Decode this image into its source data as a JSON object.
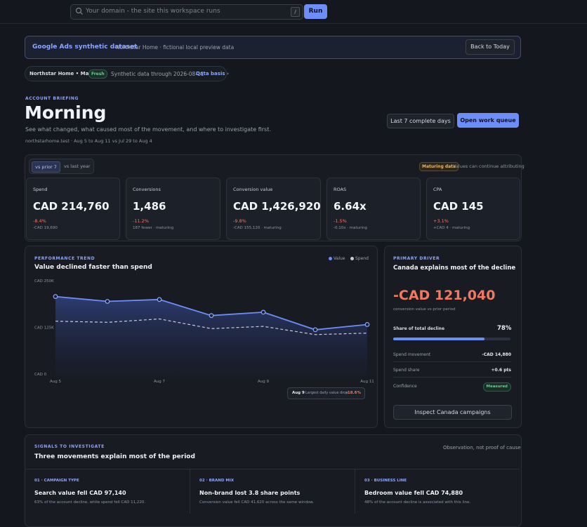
{
  "search": {
    "placeholder": "Your domain - the site this workspace runs",
    "shortcut": "/",
    "run_label": "Run"
  },
  "banner": {
    "title": "Google Ads synthetic dataset",
    "subtitle": "Northstar Home · fictional local preview data",
    "back_label": "Back to Today"
  },
  "status_pill": {
    "account": "Northstar Home • Main",
    "badge": "Fresh",
    "note": "Synthetic data through 2026-08-11",
    "link": "Data basis ›"
  },
  "briefing": {
    "eyebrow": "ACCOUNT BRIEFING",
    "title": "Morning",
    "subtitle": "See what changed, what caused most of the movement, and where to investigate first.",
    "meta": "northstarhome.test · Aug 5 to Aug 11 vs Jul 29 to Aug 4",
    "range_label": "Last 7 complete days",
    "queue_label": "Open work queue"
  },
  "comparison": {
    "prior": "vs prior 7",
    "last_year": "vs last year",
    "maturing_badge": "Maturing data",
    "maturing_note": "Values can continue attributing"
  },
  "kpis": [
    {
      "label": "Spend",
      "value": "CAD 214,760",
      "change": "-8.4%",
      "detail": "-CAD 19,690",
      "change_color": "#f0795f"
    },
    {
      "label": "Conversions",
      "value": "1,486",
      "change": "-11.2%",
      "detail": "187 fewer · maturing",
      "change_color": "#f0795f"
    },
    {
      "label": "Conversion value",
      "value": "CAD 1,426,920",
      "change": "-9.8%",
      "detail": "-CAD 155,120 · maturing",
      "change_color": "#f0795f"
    },
    {
      "label": "ROAS",
      "value": "6.64x",
      "change": "-1.5%",
      "detail": "-0.10x · maturing",
      "change_color": "#f0795f"
    },
    {
      "label": "CPA",
      "value": "CAD 145",
      "change": "+3.1%",
      "detail": "+CAD 4 · maturing",
      "change_color": "#f0795f"
    }
  ],
  "trend": {
    "eyebrow": "PERFORMANCE TREND",
    "title": "Value declined faster than spend",
    "legend_value": "Value",
    "legend_spend": "Spend",
    "callout_day": "Aug 9",
    "callout_text": "Largest daily value drop",
    "callout_change": "-18.6%"
  },
  "chart_data": {
    "type": "line",
    "x": [
      "Aug 5",
      "Aug 6",
      "Aug 7",
      "Aug 8",
      "Aug 9",
      "Aug 10",
      "Aug 11"
    ],
    "x_tick_labels": [
      "Aug 5",
      "Aug 7",
      "Aug 9",
      "Aug 11"
    ],
    "y_tick_labels": [
      "CAD 250K",
      "CAD 125K",
      "CAD 0"
    ],
    "ylim": [
      0,
      250000
    ],
    "series": [
      {
        "name": "Value",
        "values": [
          217000,
          204000,
          209000,
          166000,
          175000,
          128000,
          142000
        ],
        "color": "#6e8ef7",
        "markers": true,
        "area": true
      },
      {
        "name": "Spend",
        "values": [
          151000,
          148000,
          157000,
          131000,
          137000,
          115000,
          119000
        ],
        "color": "#c8ccd4",
        "dashed": true
      }
    ],
    "grid": false,
    "legend": "top-right"
  },
  "driver": {
    "eyebrow": "PRIMARY DRIVER",
    "title": "Canada explains most of the decline",
    "amount": "-CAD 121,040",
    "amount_note": "conversion value vs prior period",
    "share_label": "Share of total decline",
    "share_value": "78%",
    "share_fraction": 0.78,
    "rows": [
      {
        "label": "Spend movement",
        "value": "-CAD 14,880"
      },
      {
        "label": "Spend share",
        "value": "+0.6 pts"
      },
      {
        "label": "Confidence",
        "value": "Measured"
      }
    ],
    "inspect_label": "Inspect Canada campaigns"
  },
  "signals": {
    "eyebrow": "SIGNALS TO INVESTIGATE",
    "title": "Three movements explain most of the period",
    "note": "Observation, not proof of cause",
    "items": [
      {
        "tag": "01 · CAMPAIGN TYPE",
        "headline": "Search value fell CAD 97,140",
        "detail": "63% of the account decline, while spend fell CAD 11,220."
      },
      {
        "tag": "02 · BRAND MIX",
        "headline": "Non-brand lost 3.8 share points",
        "detail": "Conversion value fell CAD 41,620 across the same window."
      },
      {
        "tag": "03 · BUSINESS LINE",
        "headline": "Bedroom value fell CAD 74,880",
        "detail": "48% of the account decline is associated with this line."
      }
    ]
  }
}
